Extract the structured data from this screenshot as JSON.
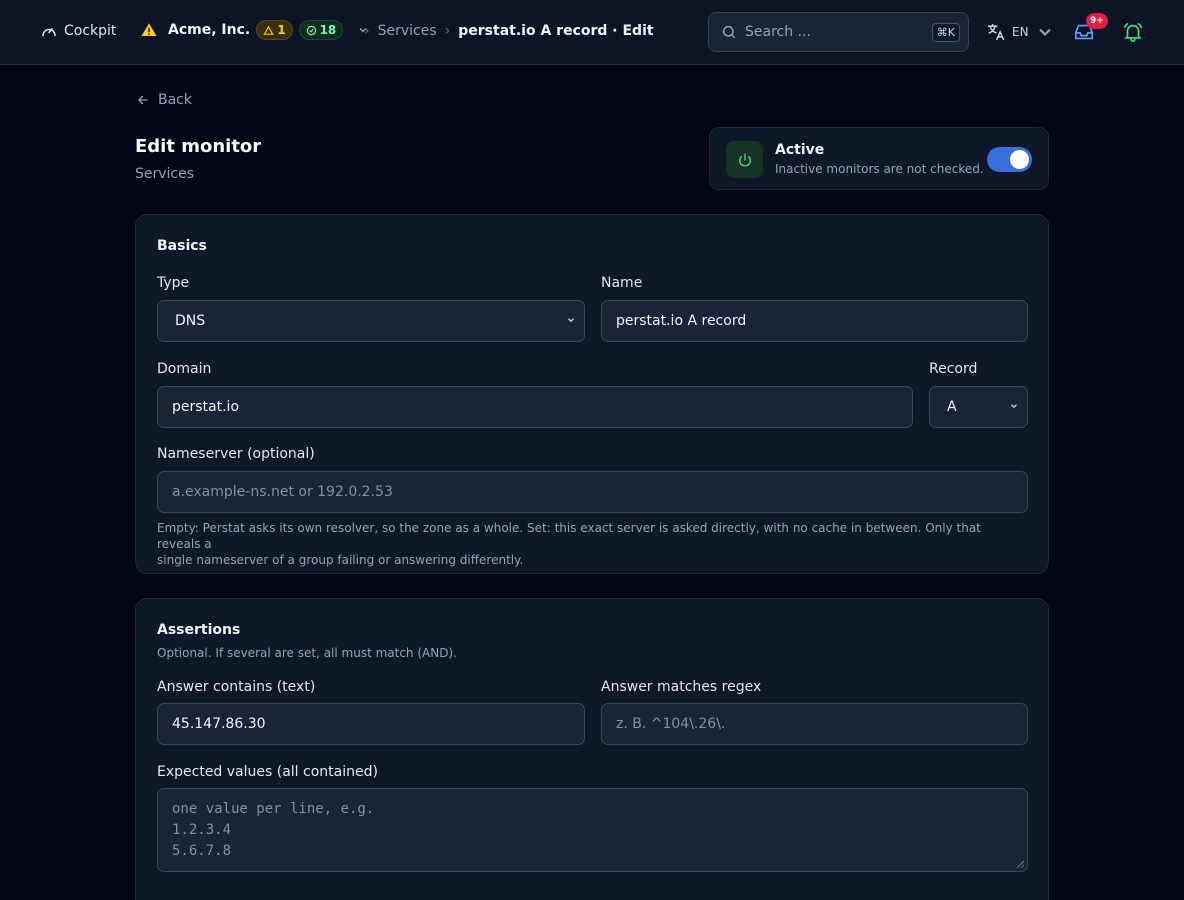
{
  "topbar": {
    "brand": "Cockpit",
    "org_name": "Acme, Inc.",
    "warn_count": "1",
    "ok_count": "18",
    "breadcrumb": {
      "section": "Services",
      "current": "perstat.io A record · Edit"
    },
    "search_placeholder": "Search ...",
    "search_shortcut": "⌘K",
    "language": "EN",
    "inbox_badge": "9+"
  },
  "header": {
    "back_label": "Back",
    "title": "Edit monitor",
    "subtitle": "Services",
    "active": {
      "title": "Active",
      "description": "Inactive monitors are not checked.",
      "enabled": true
    }
  },
  "basics": {
    "title": "Basics",
    "type_label": "Type",
    "type_value": "DNS",
    "name_label": "Name",
    "name_value": "perstat.io A record",
    "domain_label": "Domain",
    "domain_value": "perstat.io",
    "record_label": "Record",
    "record_value": "A",
    "nameserver_label": "Nameserver (optional)",
    "nameserver_placeholder": "a.example-ns.net or 192.0.2.53",
    "nameserver_help_1": "Empty: Perstat asks its own resolver, so the zone as a whole. Set: this exact server is asked directly, with no cache in between. Only that reveals a",
    "nameserver_help_2": "single nameserver of a group failing or answering differently."
  },
  "assertions": {
    "title": "Assertions",
    "subtitle": "Optional. If several are set, all must match (AND).",
    "contains_label": "Answer contains (text)",
    "contains_value": "45.147.86.30",
    "regex_label": "Answer matches regex",
    "regex_placeholder": "z. B. ^104\\.26\\.",
    "expected_label": "Expected values (all contained)",
    "expected_placeholder": [
      "one value per line, e.g.",
      "1.2.3.4",
      "5.6.7.8"
    ]
  },
  "colors": {
    "accent": "#3b6fe0",
    "warn": "#facc15",
    "ok": "#86efac",
    "danger": "#e11d48",
    "background": "#030617"
  }
}
